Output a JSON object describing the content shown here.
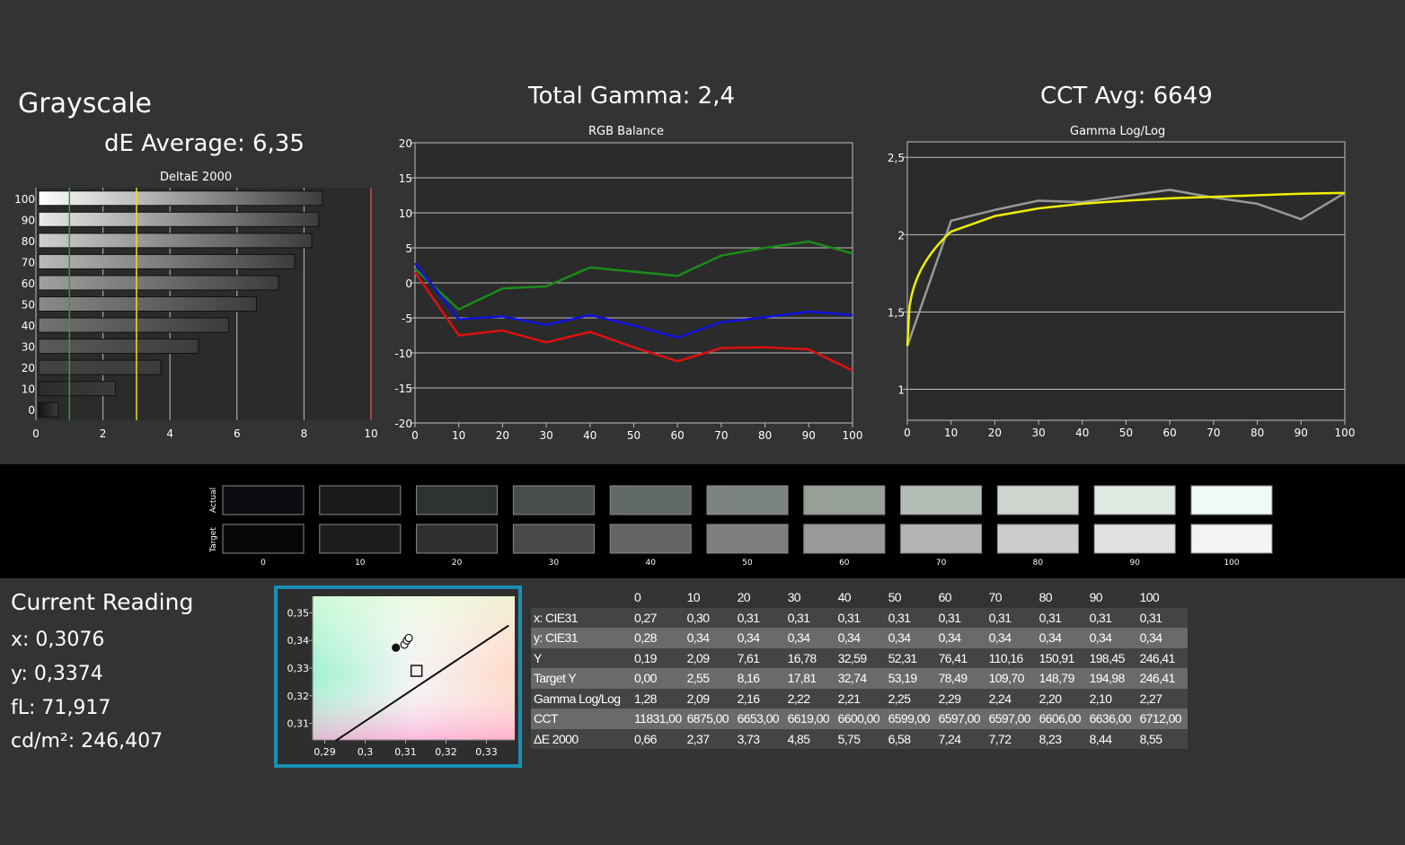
{
  "titles": {
    "grayscale": "Grayscale",
    "de_average": "dE Average: 6,35",
    "total_gamma": "Total Gamma: 2,4",
    "cct_avg": "CCT Avg: 6649"
  },
  "colors": {
    "background": "#333333",
    "plot_bg": "#2b2b2b",
    "grid": "#bfbfbf",
    "red": "#e01010",
    "green": "#1a8c1a",
    "blue": "#1010e0",
    "yellow": "#f0f000",
    "gray_line": "#999999",
    "accent_frame": "#1b8fb4"
  },
  "chart_data": [
    {
      "type": "bar",
      "title": "DeltaE 2000",
      "orientation": "horizontal",
      "categories": [
        "0",
        "10",
        "20",
        "30",
        "40",
        "50",
        "60",
        "70",
        "80",
        "90",
        "100"
      ],
      "values": [
        0.66,
        2.37,
        3.73,
        4.85,
        5.75,
        6.58,
        7.24,
        7.72,
        8.23,
        8.44,
        8.55
      ],
      "xlim": [
        0,
        10
      ],
      "xticks": [
        "0",
        "2",
        "4",
        "6",
        "8",
        "10"
      ],
      "reference_lines": [
        1,
        3,
        10
      ]
    },
    {
      "type": "line",
      "title": "RGB Balance",
      "x": [
        0,
        10,
        20,
        30,
        40,
        50,
        60,
        70,
        80,
        90,
        100
      ],
      "ylim": [
        -20,
        20
      ],
      "yticks": [
        "20",
        "15",
        "10",
        "5",
        "0",
        "-5",
        "-10",
        "-15",
        "-20"
      ],
      "xticks": [
        "0",
        "10",
        "20",
        "30",
        "40",
        "50",
        "60",
        "70",
        "80",
        "90",
        "100"
      ],
      "series": [
        {
          "color": "red",
          "values": [
            1.5,
            -7.5,
            -6.8,
            -8.5,
            -7.0,
            -9.2,
            -11.2,
            -9.3,
            -9.2,
            -9.5,
            -12.5
          ]
        },
        {
          "color": "green",
          "values": [
            2.0,
            -3.8,
            -0.8,
            -0.5,
            2.2,
            1.6,
            1.0,
            3.9,
            5.0,
            5.9,
            4.2
          ]
        },
        {
          "color": "blue",
          "values": [
            2.8,
            -5.2,
            -4.8,
            -6.0,
            -4.6,
            -6.1,
            -7.8,
            -5.6,
            -4.9,
            -4.1,
            -4.6
          ]
        }
      ]
    },
    {
      "type": "line",
      "title": "Gamma Log/Log",
      "x": [
        0,
        10,
        20,
        30,
        40,
        50,
        60,
        70,
        80,
        90,
        100
      ],
      "ylim": [
        0.8,
        2.6
      ],
      "yticks": [
        "2,5",
        "2",
        "1,5",
        "1"
      ],
      "xticks": [
        "0",
        "10",
        "20",
        "30",
        "40",
        "50",
        "60",
        "70",
        "80",
        "90",
        "100"
      ],
      "series": [
        {
          "color": "gray",
          "values": [
            1.28,
            2.09,
            2.16,
            2.22,
            2.21,
            2.25,
            2.29,
            2.24,
            2.2,
            2.1,
            2.27
          ]
        },
        {
          "color": "yellow",
          "values": [
            1.28,
            2.02,
            2.12,
            2.17,
            2.2,
            2.22,
            2.235,
            2.245,
            2.255,
            2.265,
            2.27
          ]
        }
      ]
    },
    {
      "type": "scatter",
      "title": "CIE xy",
      "xlim": [
        0.287,
        0.337
      ],
      "ylim": [
        0.304,
        0.356
      ],
      "xticks": [
        "0,29",
        "0,3",
        "0,31",
        "0,32",
        "0,33"
      ],
      "yticks": [
        "0,35",
        "0,34",
        "0,33",
        "0,32",
        "0,31"
      ],
      "points": [
        {
          "x": 0.3076,
          "y": 0.3374,
          "filled": true
        },
        {
          "x": 0.3097,
          "y": 0.3385,
          "filled": false
        },
        {
          "x": 0.3103,
          "y": 0.34,
          "filled": false
        },
        {
          "x": 0.3108,
          "y": 0.3409,
          "filled": false
        }
      ],
      "target": {
        "x": 0.3127,
        "y": 0.329
      },
      "planckian": [
        [
          0.2926,
          0.3036
        ],
        [
          0.3355,
          0.3454
        ]
      ]
    }
  ],
  "swatches": {
    "actual_label": "Actual",
    "target_label": "Target",
    "labels": [
      "0",
      "10",
      "20",
      "30",
      "40",
      "50",
      "60",
      "70",
      "80",
      "90",
      "100"
    ],
    "actual_colors": [
      "#0b0d10",
      "#181b1a",
      "#2e3330",
      "#474d4a",
      "#616964",
      "#7b847e",
      "#969f98",
      "#b4bdb6",
      "#cdd5ce",
      "#e0e8e2",
      "#eefaf3"
    ],
    "target_colors": [
      "#070707",
      "#1c1c1c",
      "#303030",
      "#494949",
      "#646464",
      "#7e7e7e",
      "#9a9a9a",
      "#b4b4b4",
      "#cccccc",
      "#e2e2e2",
      "#f3f3f3"
    ]
  },
  "reading": {
    "title": "Current Reading",
    "x": "x: 0,3076",
    "y": "y: 0,3374",
    "fl": "fL: 71,917",
    "cd": "cd/m²: 246,407"
  },
  "table": {
    "columns": [
      "0",
      "10",
      "20",
      "30",
      "40",
      "50",
      "60",
      "70",
      "80",
      "90",
      "100"
    ],
    "rows": [
      {
        "label": "x: CIE31",
        "values": [
          "0,27",
          "0,30",
          "0,31",
          "0,31",
          "0,31",
          "0,31",
          "0,31",
          "0,31",
          "0,31",
          "0,31",
          "0,31"
        ]
      },
      {
        "label": "y: CIE31",
        "values": [
          "0,28",
          "0,34",
          "0,34",
          "0,34",
          "0,34",
          "0,34",
          "0,34",
          "0,34",
          "0,34",
          "0,34",
          "0,34"
        ]
      },
      {
        "label": "Y",
        "values": [
          "0,19",
          "2,09",
          "7,61",
          "16,78",
          "32,59",
          "52,31",
          "76,41",
          "110,16",
          "150,91",
          "198,45",
          "246,41"
        ]
      },
      {
        "label": "Target Y",
        "values": [
          "0,00",
          "2,55",
          "8,16",
          "17,81",
          "32,74",
          "53,19",
          "78,49",
          "109,70",
          "148,79",
          "194,98",
          "246,41"
        ]
      },
      {
        "label": "Gamma Log/Log",
        "values": [
          "1,28",
          "2,09",
          "2,16",
          "2,22",
          "2,21",
          "2,25",
          "2,29",
          "2,24",
          "2,20",
          "2,10",
          "2,27"
        ]
      },
      {
        "label": "CCT",
        "values": [
          "11831,00",
          "6875,00",
          "6653,00",
          "6619,00",
          "6600,00",
          "6599,00",
          "6597,00",
          "6597,00",
          "6606,00",
          "6636,00",
          "6712,00"
        ]
      },
      {
        "label": "ΔE 2000",
        "values": [
          "0,66",
          "2,37",
          "3,73",
          "4,85",
          "5,75",
          "6,58",
          "7,24",
          "7,72",
          "8,23",
          "8,44",
          "8,55"
        ]
      }
    ]
  }
}
